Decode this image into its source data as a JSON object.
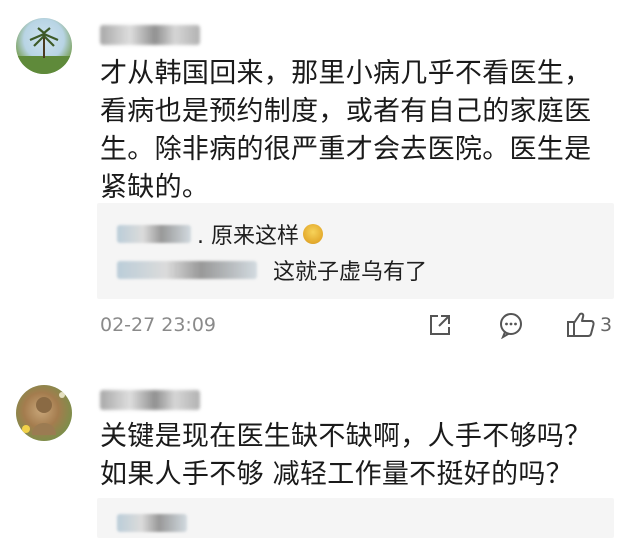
{
  "comments": [
    {
      "body": "才从韩国回来，那里小病几乎不看医生，\n看病也是预约制度，或者有自己的家庭医\n生。除非病的很严重才会去医院。医生是\n紧缺的。",
      "replies": [
        {
          "text": ". 原来这样"
        },
        {
          "text": "这就子虚乌有了"
        }
      ],
      "timestamp": "02-27 23:09",
      "like_count": "3",
      "icons": [
        "share-icon",
        "comment-icon",
        "like-icon"
      ]
    },
    {
      "body": "关键是现在医生缺不缺啊，人手不够吗？\n如果人手不够 减轻工作量不挺好的吗？",
      "replies": [
        {
          "text": ""
        }
      ]
    }
  ],
  "colors": {
    "reply_bg": "#f5f5f5",
    "timestamp": "#8a8a8a",
    "text": "#1a1a1a"
  }
}
